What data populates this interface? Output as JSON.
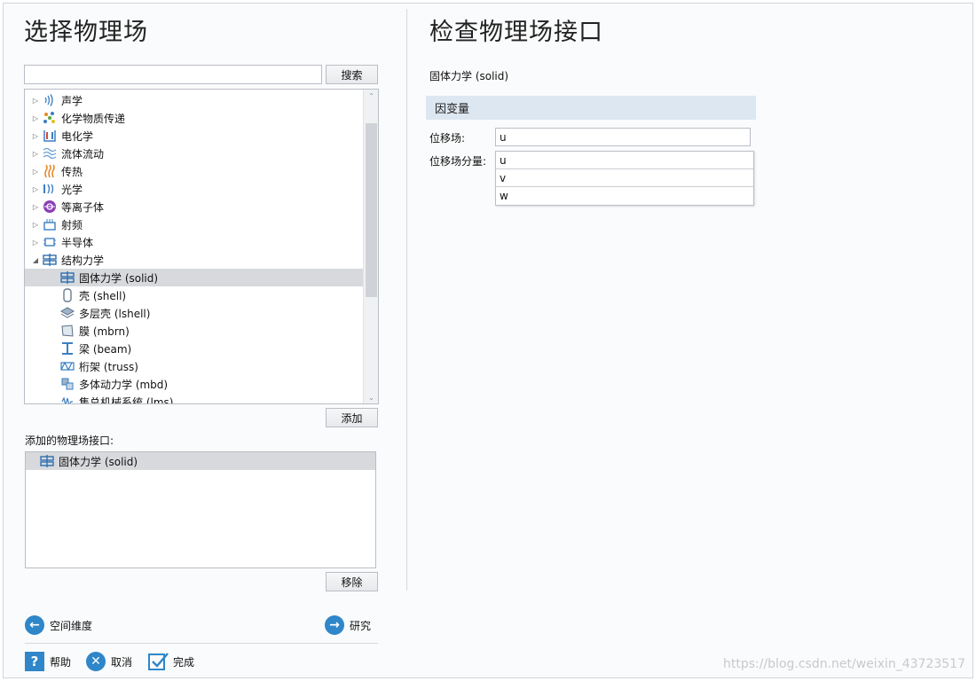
{
  "left": {
    "title": "选择物理场",
    "search": {
      "value": "",
      "placeholder": "",
      "button": "搜索"
    },
    "tree": [
      {
        "label": "声学",
        "icon": "acoustics-icon",
        "level": 0,
        "state": "collapsed"
      },
      {
        "label": "化学物质传递",
        "icon": "chemical-transport-icon",
        "level": 0,
        "state": "collapsed"
      },
      {
        "label": "电化学",
        "icon": "electrochemistry-icon",
        "level": 0,
        "state": "collapsed"
      },
      {
        "label": "流体流动",
        "icon": "fluid-flow-icon",
        "level": 0,
        "state": "collapsed"
      },
      {
        "label": "传热",
        "icon": "heat-transfer-icon",
        "level": 0,
        "state": "collapsed"
      },
      {
        "label": "光学",
        "icon": "optics-icon",
        "level": 0,
        "state": "collapsed"
      },
      {
        "label": "等离子体",
        "icon": "plasma-icon",
        "level": 0,
        "state": "collapsed"
      },
      {
        "label": "射频",
        "icon": "rf-icon",
        "level": 0,
        "state": "collapsed"
      },
      {
        "label": "半导体",
        "icon": "semiconductor-icon",
        "level": 0,
        "state": "collapsed"
      },
      {
        "label": "结构力学",
        "icon": "structural-mechanics-icon",
        "level": 0,
        "state": "expanded"
      },
      {
        "label": "固体力学 (solid)",
        "icon": "solid-mechanics-icon",
        "level": 1,
        "selected": true
      },
      {
        "label": "壳 (shell)",
        "icon": "shell-icon",
        "level": 1
      },
      {
        "label": "多层壳 (lshell)",
        "icon": "layered-shell-icon",
        "level": 1
      },
      {
        "label": "膜 (mbrn)",
        "icon": "membrane-icon",
        "level": 1
      },
      {
        "label": "梁 (beam)",
        "icon": "beam-icon",
        "level": 1
      },
      {
        "label": "桁架 (truss)",
        "icon": "truss-icon",
        "level": 1
      },
      {
        "label": "多体动力学 (mbd)",
        "icon": "multibody-icon",
        "level": 1
      },
      {
        "label": "集总机械系统 (lms)",
        "icon": "lumped-mechanical-icon",
        "level": 1
      }
    ],
    "add_button": "添加",
    "added_label": "添加的物理场接口:",
    "added_items": [
      {
        "label": "固体力学 (solid)",
        "icon": "solid-mechanics-icon"
      }
    ],
    "remove_button": "移除",
    "nav_back": "空间维度",
    "nav_next": "研究",
    "help": "帮助",
    "cancel": "取消",
    "done": "完成"
  },
  "right": {
    "title": "检查物理场接口",
    "subtitle": "固体力学 (solid)",
    "section": "因变量",
    "field_label": "位移场:",
    "field_value": "u",
    "components_label": "位移场分量:",
    "components": [
      "u",
      "v",
      "w"
    ]
  },
  "watermark": "https://blog.csdn.net/weixin_43723517",
  "colors": {
    "accent": "#2f86c9",
    "selection": "#d7d9dc",
    "section_bar": "#dde7f1"
  }
}
